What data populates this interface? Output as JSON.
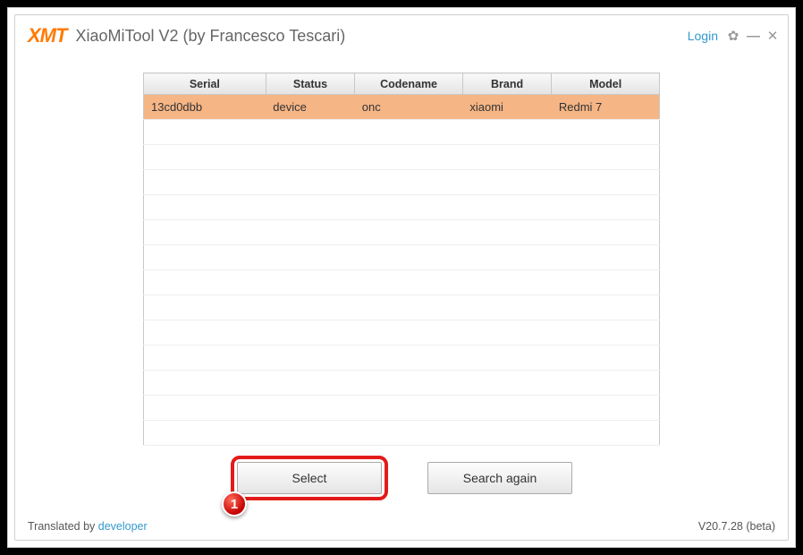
{
  "header": {
    "logo": "XMT",
    "title": "XiaoMiTool V2 (by Francesco Tescari)",
    "login": "Login"
  },
  "table": {
    "headers": [
      "Serial",
      "Status",
      "Codename",
      "Brand",
      "Model"
    ],
    "rows": [
      {
        "serial": "13cd0dbb",
        "status": "device",
        "codename": "onc",
        "brand": "xiaomi",
        "model": "Redmi 7",
        "selected": true
      }
    ],
    "emptyRows": 13
  },
  "buttons": {
    "select": "Select",
    "search_again": "Search again"
  },
  "callout": "1",
  "footer": {
    "translated_prefix": "Translated by ",
    "translated_link": "developer",
    "version": "V20.7.28 (beta)"
  }
}
